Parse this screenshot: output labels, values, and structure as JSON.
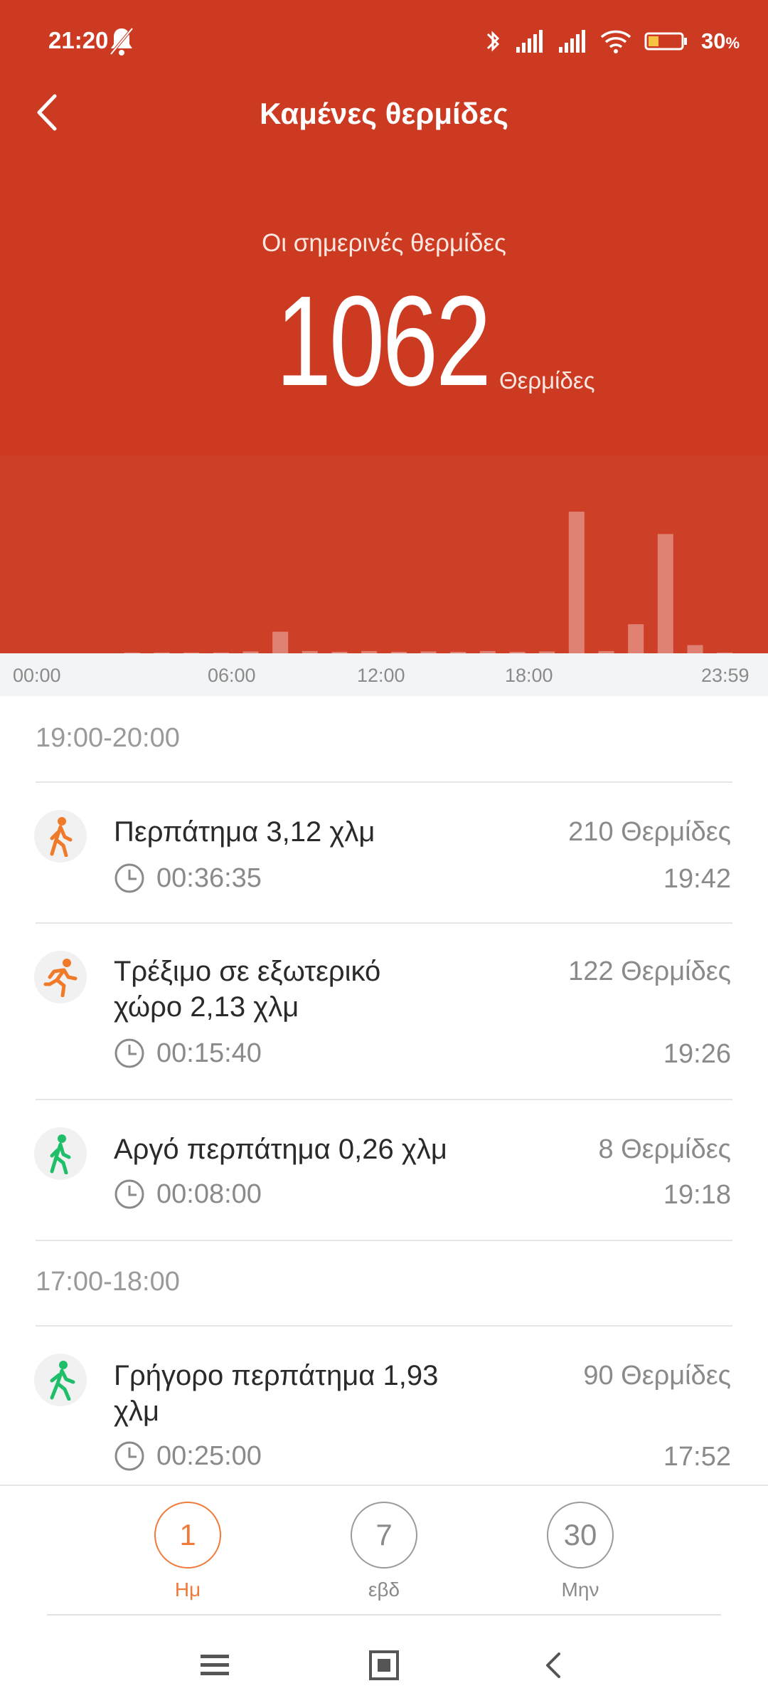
{
  "status_bar": {
    "time": "21:20",
    "battery_percent": "30",
    "battery_unit": "%",
    "icons": [
      "alarm-off-icon",
      "bluetooth-icon",
      "signal-icon",
      "signal-icon",
      "wifi-icon",
      "battery-icon"
    ]
  },
  "header": {
    "title": "Καμένες θερμίδες",
    "today_label": "Οι σημερινές θερμίδες",
    "calories_value": "1062",
    "calories_unit": "Θερμίδες",
    "background_color": "#CD3A22"
  },
  "chart_data": {
    "type": "bar",
    "x_ticks": [
      "00:00",
      "06:00",
      "12:00",
      "18:00",
      "23:59"
    ],
    "bar_hours": [
      3,
      4,
      5,
      6,
      7,
      8,
      9,
      10,
      11,
      12,
      13,
      14,
      15,
      16,
      17,
      18,
      19,
      20,
      21,
      22,
      23
    ],
    "values": [
      2,
      2,
      2,
      2,
      5,
      58,
      6,
      4,
      6,
      4,
      5,
      4,
      6,
      4,
      5,
      380,
      6,
      78,
      320,
      22,
      2
    ],
    "ylim": [
      0,
      420
    ]
  },
  "groups": [
    {
      "range": "19:00-20:00",
      "items": [
        {
          "icon": "walking-icon",
          "title": "Περπάτημα 3,12 χλμ",
          "calories": "210 Θερμίδες",
          "duration": "00:36:35",
          "time": "19:42",
          "color": "#EF7A2A"
        },
        {
          "icon": "running-icon",
          "title": "Τρέξιμο σε εξωτερικό χώρο 2,13 χλμ",
          "calories": "122 Θερμίδες",
          "duration": "00:15:40",
          "time": "19:26",
          "color": "#EF7A2A"
        },
        {
          "icon": "slow-walking-icon",
          "title": "Αργό περπάτημα 0,26 χλμ",
          "calories": "8 Θερμίδες",
          "duration": "00:08:00",
          "time": "19:18",
          "color": "#1FBF6A"
        }
      ]
    },
    {
      "range": "17:00-18:00",
      "items": [
        {
          "icon": "brisk-walking-icon",
          "title": "Γρήγορο περπάτημα 1,93 χλμ",
          "calories": "90 Θερμίδες",
          "duration": "00:25:00",
          "time": "17:52",
          "color": "#1FBF6A"
        }
      ]
    }
  ],
  "periods": [
    {
      "value": "1",
      "label": "Ημ",
      "active": true
    },
    {
      "value": "7",
      "label": "εβδ",
      "active": false
    },
    {
      "value": "30",
      "label": "Μην",
      "active": false
    }
  ],
  "accent_color": "#EF7A3A"
}
